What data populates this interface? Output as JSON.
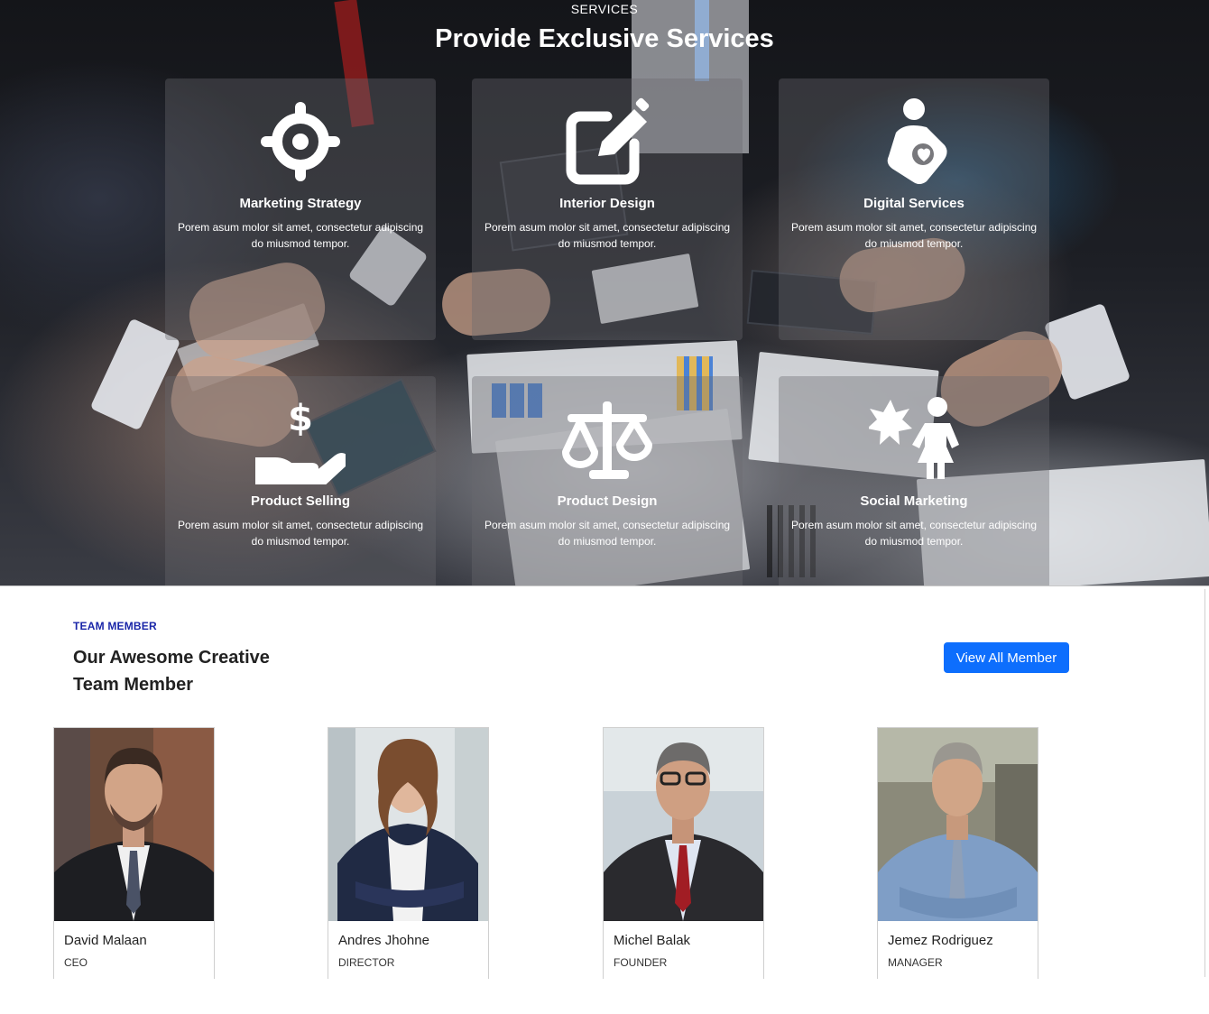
{
  "services": {
    "eyebrow": "SERVICES",
    "title": "Provide Exclusive Services",
    "cards": [
      {
        "icon": "crosshair-icon",
        "title": "Marketing Strategy",
        "desc": "Porem asum molor sit amet, consectetur adipiscing do miusmod tempor."
      },
      {
        "icon": "edit-icon",
        "title": "Interior Design",
        "desc": "Porem asum molor sit amet, consectetur adipiscing do miusmod tempor."
      },
      {
        "icon": "person-holding-heart-icon",
        "title": "Digital Services",
        "desc": "Porem asum molor sit amet, consectetur adipiscing do miusmod tempor."
      },
      {
        "icon": "hand-holding-dollar-icon",
        "title": "Product Selling",
        "desc": "Porem asum molor sit amet, consectetur adipiscing do miusmod tempor."
      },
      {
        "icon": "scale-balanced-icon",
        "title": "Product Design",
        "desc": "Porem asum molor sit amet, consectetur adipiscing do miusmod tempor."
      },
      {
        "icon": "child-reaching-icon",
        "title": "Social Marketing",
        "desc": "Porem asum molor sit amet, consectetur adipiscing do miusmod tempor."
      }
    ]
  },
  "team": {
    "eyebrow": "TEAM MEMBER",
    "title": "Our Awesome Creative Team Member",
    "button_label": "View All Member",
    "accent_color": "#0d6efd",
    "eyebrow_color": "#1a26a8",
    "members": [
      {
        "name": "David Malaan",
        "role": "CEO"
      },
      {
        "name": "Andres Jhohne",
        "role": "DIRECTOR"
      },
      {
        "name": "Michel Balak",
        "role": "FOUNDER"
      },
      {
        "name": "Jemez Rodriguez",
        "role": "MANAGER"
      }
    ]
  }
}
